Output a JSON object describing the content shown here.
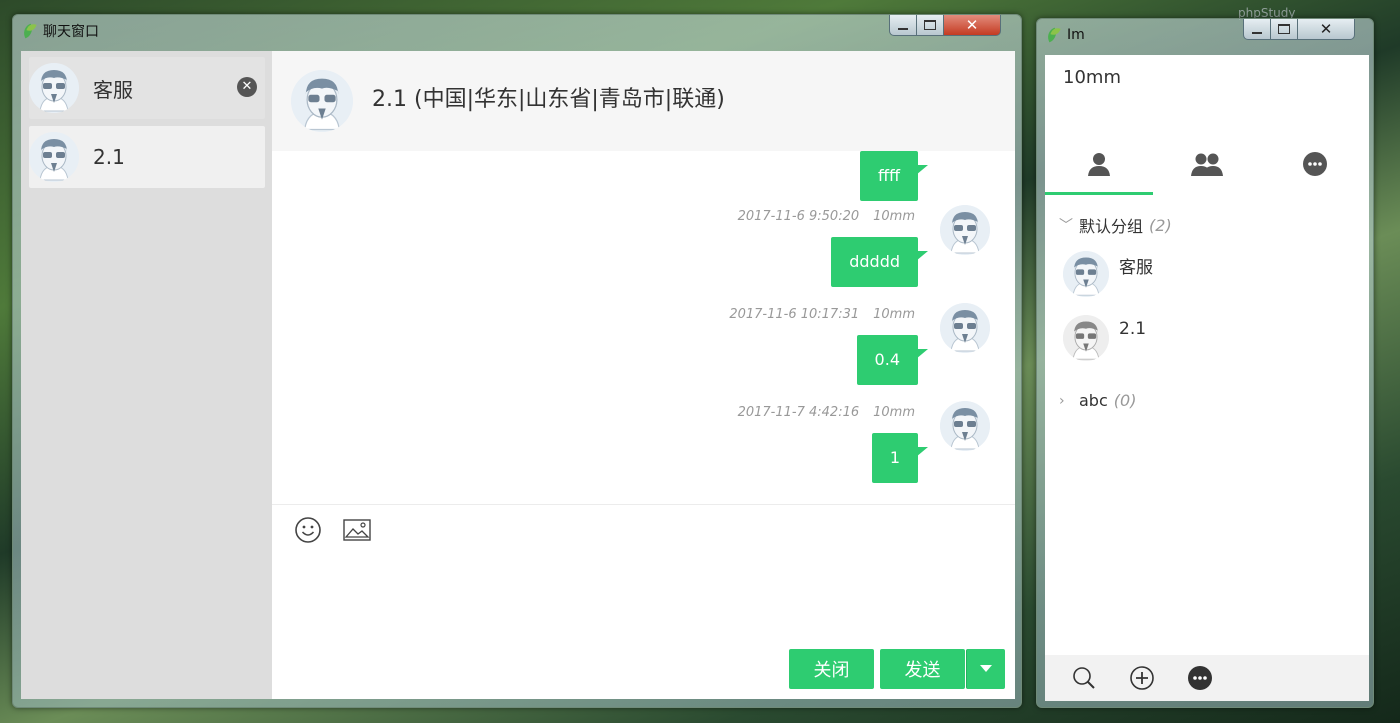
{
  "chat_window": {
    "title": "聊天窗口",
    "sidebar": [
      {
        "name": "客服"
      },
      {
        "name": "2.1"
      }
    ],
    "header_title": "2.1 (中国|华东|山东省|青岛市|联通)",
    "messages": [
      {
        "time": "",
        "user": "",
        "text": "ffff"
      },
      {
        "time": "2017-11-6 9:50:20",
        "user": "10mm",
        "text": "ddddd"
      },
      {
        "time": "2017-11-6 10:17:31",
        "user": "10mm",
        "text": "0.4"
      },
      {
        "time": "2017-11-7 4:42:16",
        "user": "10mm",
        "text": "1"
      }
    ],
    "close_label": "关闭",
    "send_label": "发送"
  },
  "im_window": {
    "title": "Im",
    "username": "10mm",
    "groups": [
      {
        "name": "默认分组",
        "count": "(2)",
        "friends": [
          {
            "name": "客服"
          },
          {
            "name": "2.1"
          }
        ]
      },
      {
        "name": "abc",
        "count": "(0)",
        "friends": []
      }
    ]
  },
  "desktop": {
    "right_label": "phpStudy"
  },
  "colors": {
    "accent": "#2ecc71",
    "close": "#c43b22"
  }
}
